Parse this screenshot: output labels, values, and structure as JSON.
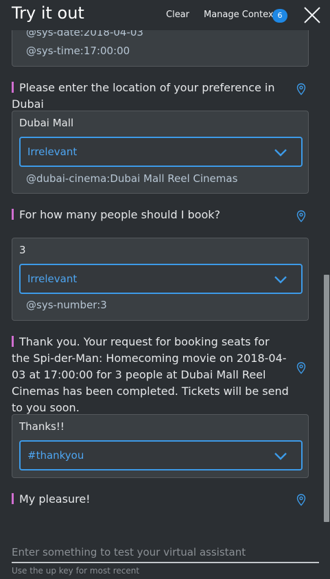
{
  "header": {
    "title": "Try it out",
    "clear_label": "Clear",
    "manage_context_label": "Manage Context",
    "context_count": "6"
  },
  "messages": {
    "top_card": {
      "entity_1": "@sys-date:2018-04-03",
      "entity_2": "@sys-time:17:00:00"
    },
    "bot_1": "Please enter the location of your preference in Dubai",
    "user_1": {
      "text": "Dubai Mall",
      "intent": "Irrelevant",
      "entity": "@dubai-cinema:Dubai Mall Reel Cinemas"
    },
    "bot_2": "For how many people should I book?",
    "user_2": {
      "text": "3",
      "intent": "Irrelevant",
      "entity": "@sys-number:3"
    },
    "bot_3": "Thank you. Your request for booking seats for the Spi-der-Man: Homecoming movie on 2018-04-03 at 17:00:00 for 3 people at Dubai Mall Reel Cinemas has been completed. Tickets will be send to you soon.",
    "user_3": {
      "text": "Thanks!!",
      "intent": "#thankyou"
    },
    "bot_4": "My pleasure!"
  },
  "footer": {
    "input_placeholder": "Enter something to test your virtual assistant",
    "hint": "Use the up key for most recent"
  },
  "colors": {
    "accent": "#3d9be9",
    "bot_bar": "#d16fd1",
    "badge": "#1e88e5",
    "background": "#2b2f33"
  },
  "icons": {
    "close": "close-icon",
    "chevron": "chevron-down-icon",
    "pin": "location-pin-icon"
  }
}
